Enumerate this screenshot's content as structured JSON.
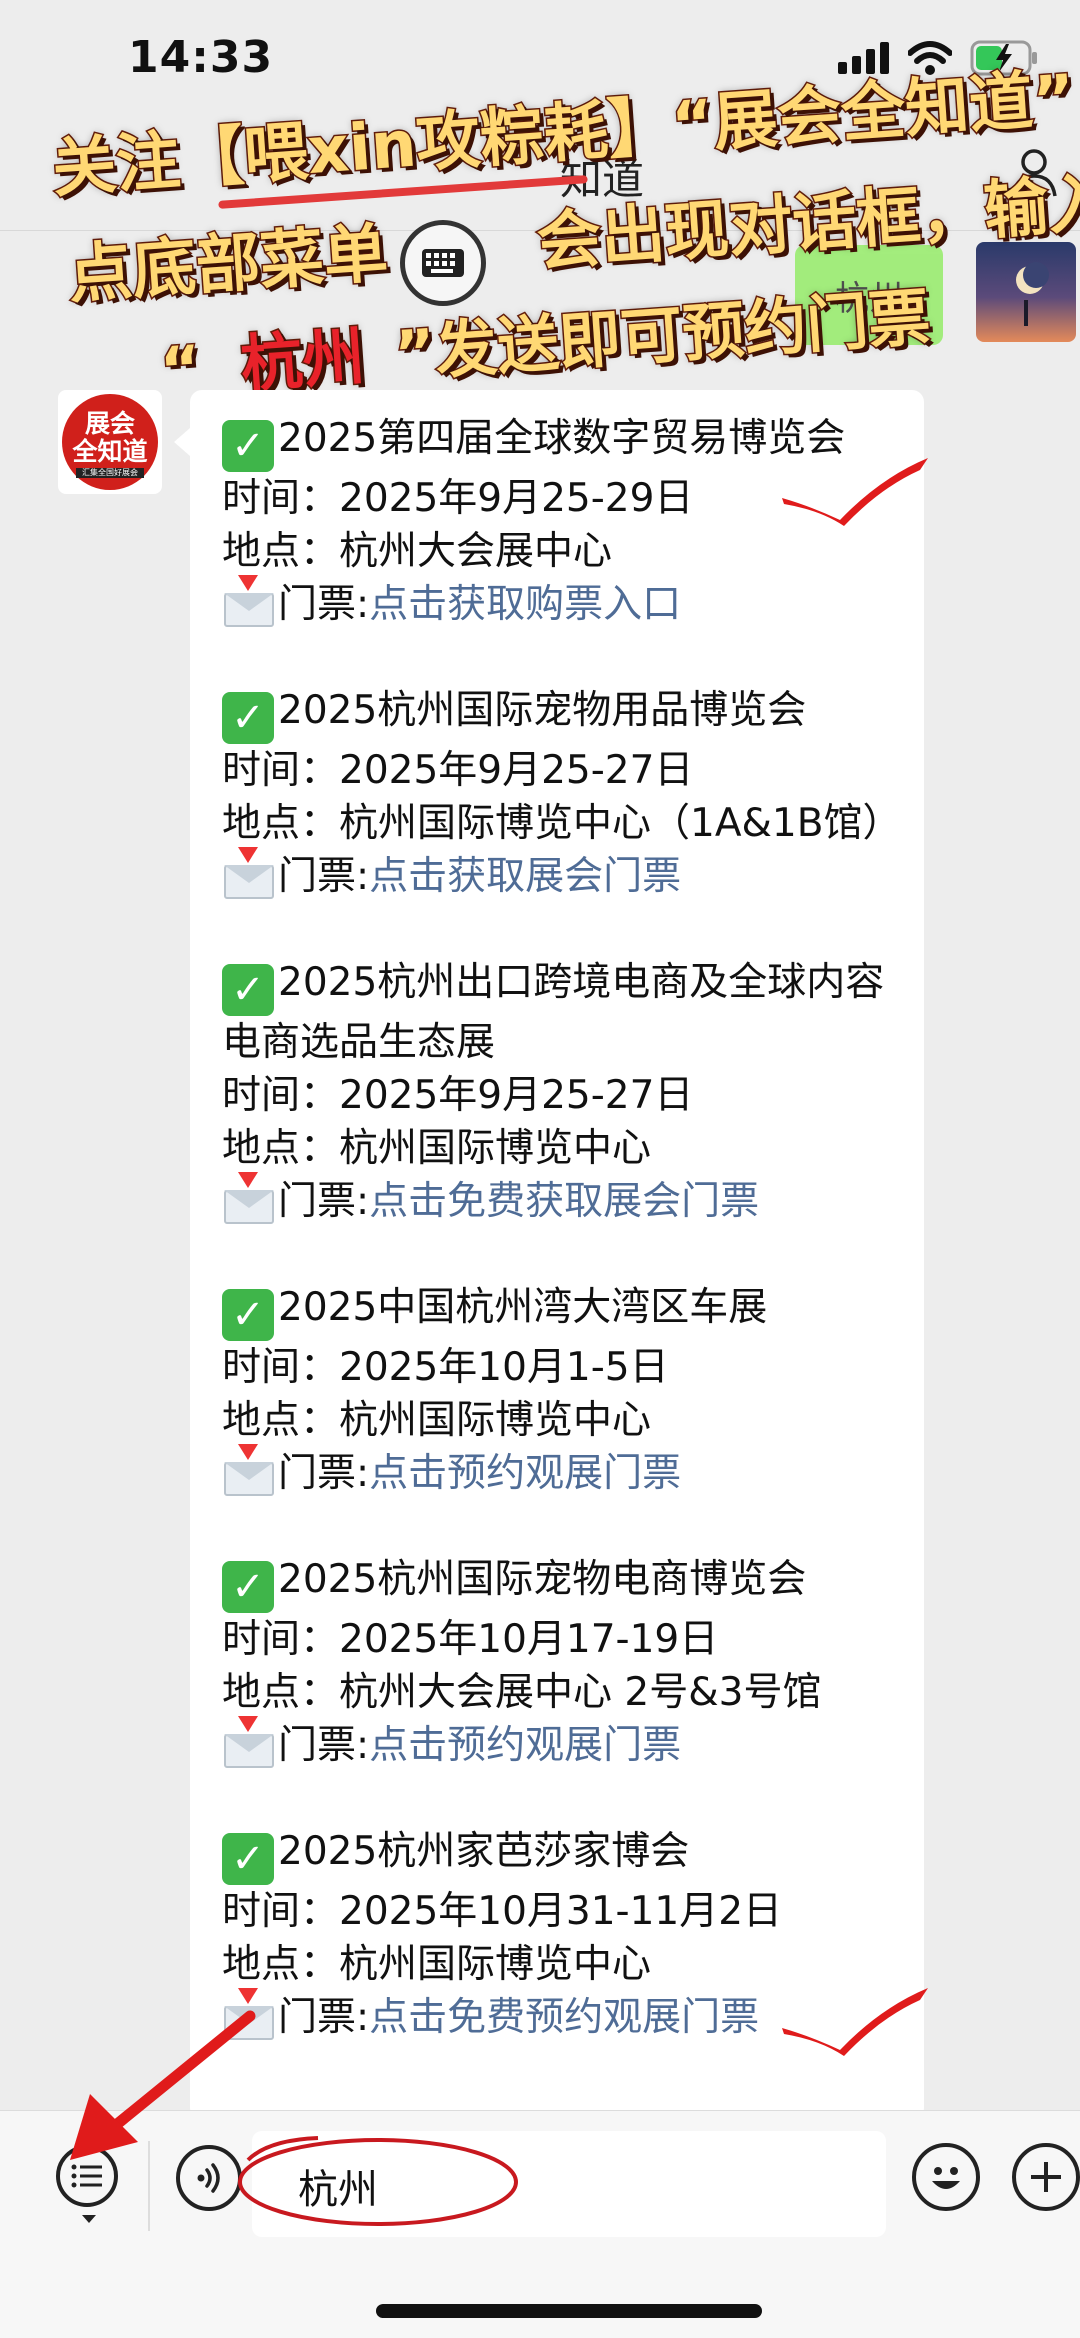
{
  "status": {
    "time": "14:33"
  },
  "header": {
    "title": "知道"
  },
  "overlay": {
    "line1_a": "关注",
    "line1_box": "【喂xin攻粽耗】",
    "line1_c": "“展会全知道”",
    "line2_a": "点底部菜单",
    "line2_b": "会出现对话框，输入",
    "line3_a": "“",
    "line3_kw": "杭州",
    "line3_c": "”发送即可预约门票"
  },
  "sent_chip": "杭州",
  "avatar": {
    "line1": "展会",
    "line2": "全知道",
    "line3": "汇集全国好展会"
  },
  "message": {
    "entries": [
      {
        "title": "2025第四届全球数字贸易博览会",
        "time_label": "时间：",
        "time": "2025年9月25-29日",
        "place_label": "地点：",
        "place": "杭州大会展中心",
        "ticket_label": "门票:",
        "ticket_link": "点击获取购票入口"
      },
      {
        "title": "2025杭州国际宠物用品博览会",
        "time_label": "时间：",
        "time": "2025年9月25-27日",
        "place_label": "地点：",
        "place": "杭州国际博览中心（1A&1B馆）",
        "ticket_label": "门票:",
        "ticket_link": "点击获取展会门票"
      },
      {
        "title": "2025杭州出口跨境电商及全球内容电商选品生态展",
        "time_label": "时间：",
        "time": "2025年9月25-27日",
        "place_label": "地点：",
        "place": "杭州国际博览中心",
        "ticket_label": "门票:",
        "ticket_link": "点击免费获取展会门票"
      },
      {
        "title": "2025中国杭州湾大湾区车展",
        "time_label": "时间：",
        "time": "2025年10月1-5日",
        "place_label": "地点：",
        "place": "杭州国际博览中心",
        "ticket_label": "门票:",
        "ticket_link": "点击预约观展门票"
      },
      {
        "title": "2025杭州国际宠物电商博览会",
        "time_label": "时间：",
        "time": "2025年10月17-19日",
        "place_label": "地点：",
        "place": "杭州大会展中心 2号&3号馆",
        "ticket_label": "门票:",
        "ticket_link": "点击预约观展门票"
      },
      {
        "title": "2025杭州家芭莎家博会",
        "time_label": "时间：",
        "time": "2025年10月31-11月2日",
        "place_label": "地点：",
        "place": "杭州国际博览中心",
        "ticket_label": "门票:",
        "ticket_link": "点击免费预约观展门票"
      }
    ]
  },
  "input": {
    "value": "杭州"
  },
  "colors": {
    "link": "#4f6c96",
    "check_green": "#3fb54a",
    "annotation_red": "#e8222a",
    "overlay_yellow": "#ffd874"
  },
  "icons": [
    "signal-icon",
    "wifi-icon",
    "battery-icon",
    "person-icon",
    "keyboard-icon",
    "check-icon",
    "envelope-icon",
    "menu-icon",
    "voice-icon",
    "emoji-icon",
    "plus-icon"
  ]
}
